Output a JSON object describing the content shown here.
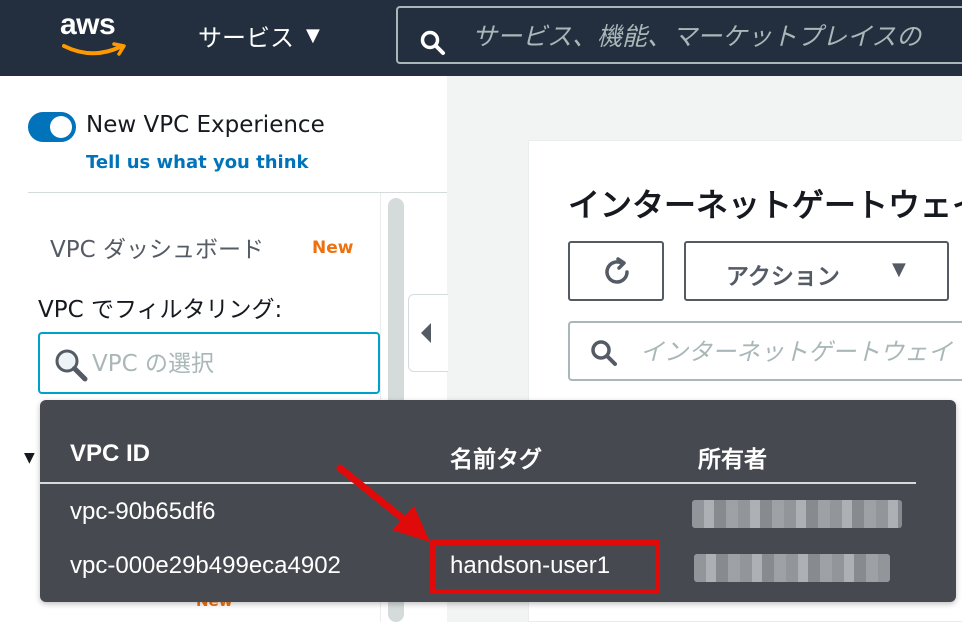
{
  "topnav": {
    "logo_text": "aws",
    "services_label": "サービス",
    "search_placeholder": "サービス、機能、マーケットプレイスの"
  },
  "sidebar": {
    "toggle_label": "New VPC Experience",
    "feedback_link": "Tell us what you think",
    "dashboard_label": "VPC ダッシュボード",
    "dashboard_badge": "New",
    "filter_label": "VPC でフィルタリング:",
    "filter_placeholder": "VPC の選択",
    "obscured_badge": "New"
  },
  "main": {
    "title": "インターネットゲートウェイ",
    "actions_label": "アクション",
    "search_placeholder": "インターネットゲートウェイ"
  },
  "dropdown": {
    "headers": {
      "vpc_id": "VPC ID",
      "name_tag": "名前タグ",
      "owner": "所有者"
    },
    "rows": [
      {
        "vpc_id": "vpc-90b65df6",
        "name_tag": ""
      },
      {
        "vpc_id": "vpc-000e29b499eca4902",
        "name_tag": "handson-user1"
      }
    ]
  },
  "colors": {
    "nav_bg": "#232f3e",
    "accent_blue": "#0073bb",
    "badge_orange": "#ec7211",
    "dropdown_bg": "#464a50",
    "highlight_red": "#e00a0a"
  }
}
